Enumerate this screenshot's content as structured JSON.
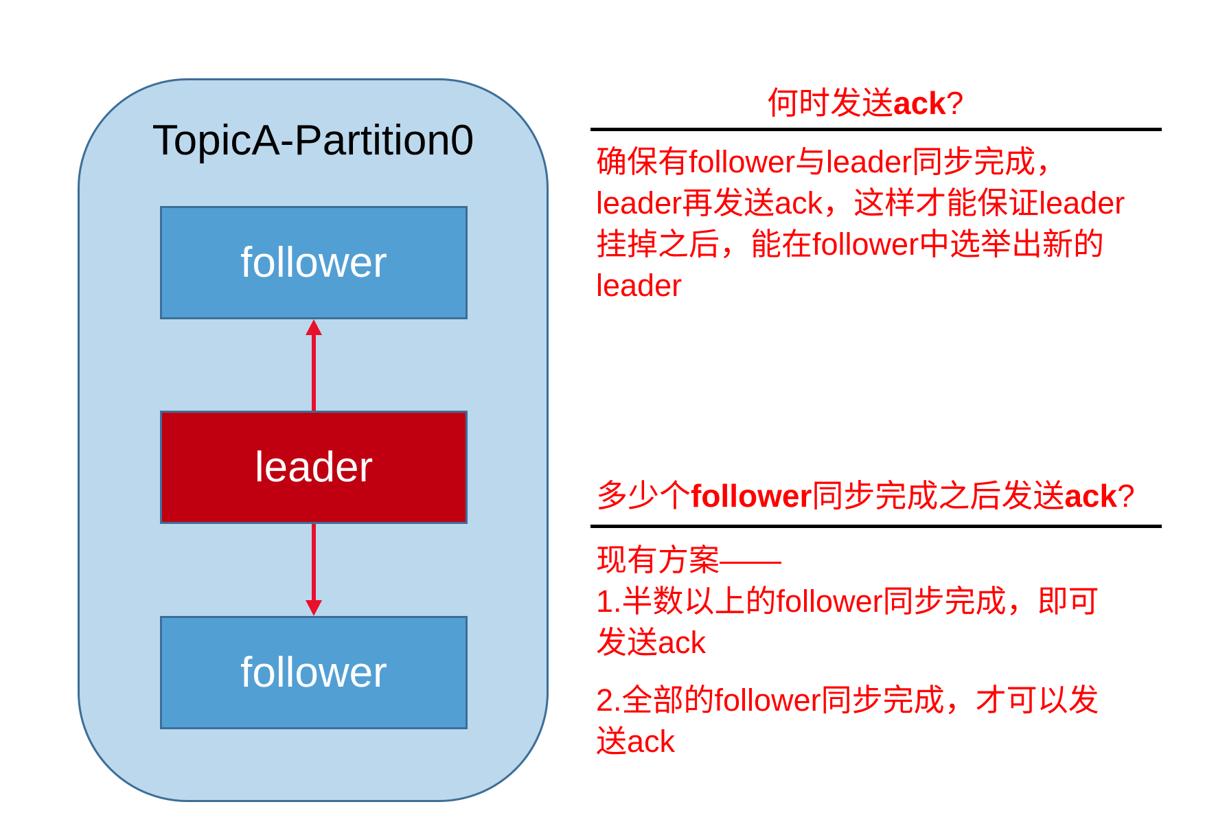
{
  "partition": {
    "title": "TopicA-Partition0"
  },
  "nodes": {
    "follower_top": "follower",
    "leader": "leader",
    "follower_bottom": "follower"
  },
  "arrow_color": "#e8102a",
  "colors": {
    "partition_fill": "#bcd8ed",
    "follower_fill": "#529fd4",
    "leader_fill": "#c00011",
    "text_accent": "#ff0000"
  },
  "section1": {
    "heading_prefix": "何时发送",
    "heading_bold": "ack",
    "heading_suffix": "?",
    "lines": [
      "确保有follower与leader同步完成，",
      "leader再发送ack，这样才能保证leader",
      "挂掉之后，能在follower中选举出新的",
      "leader"
    ]
  },
  "section2": {
    "heading_prefix": "多少个",
    "heading_bold1": "follower",
    "heading_middle": "同步完成之后发送",
    "heading_bold2": "ack",
    "heading_suffix": "?",
    "intro": "现有方案——",
    "option1_lines": [
      "1.半数以上的follower同步完成，即可",
      "发送ack"
    ],
    "option2_lines": [
      "2.全部的follower同步完成，才可以发",
      "送ack"
    ]
  }
}
